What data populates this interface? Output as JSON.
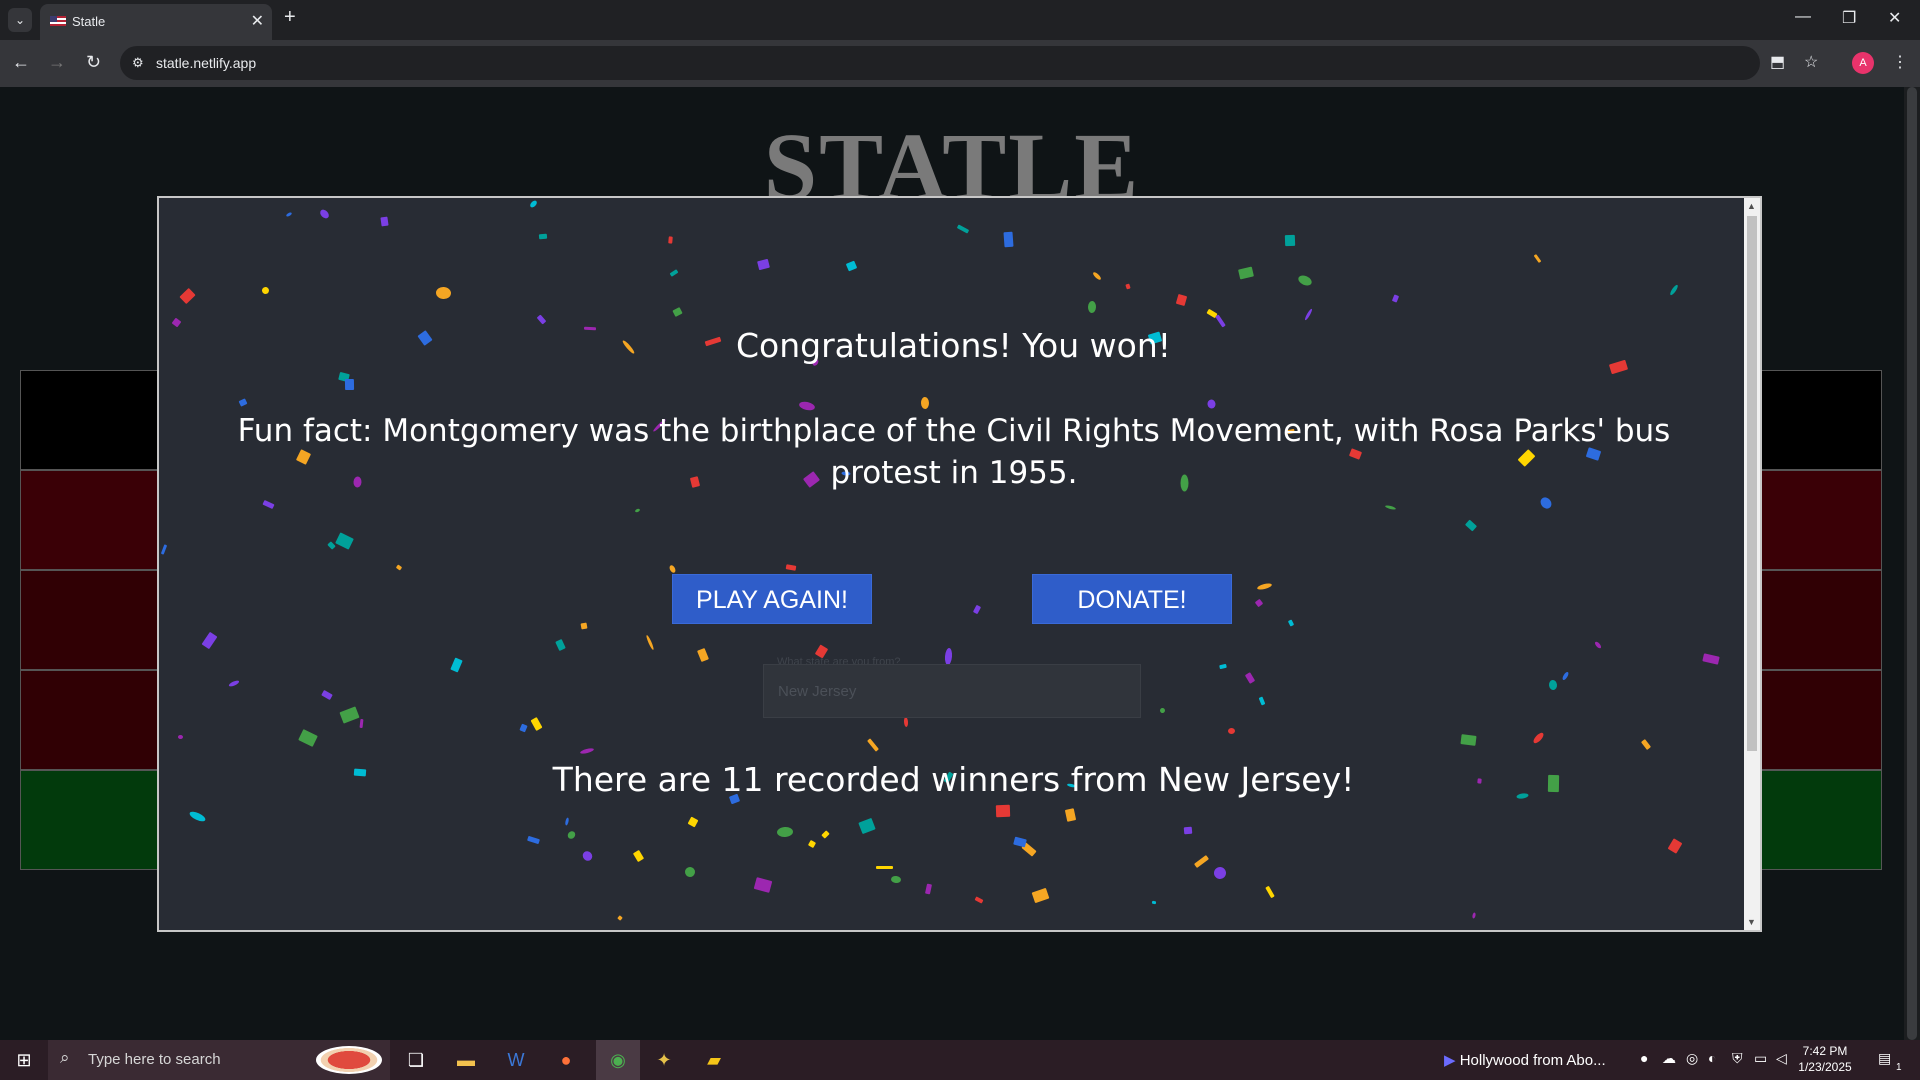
{
  "browser": {
    "tab_title": "Statle",
    "tab_close": "✕",
    "new_tab": "+",
    "url": "statle.netlify.app",
    "avatar_letter": "A"
  },
  "page": {
    "title": "STATLE"
  },
  "modal": {
    "congrats": "Congratulations! You won!",
    "fun_fact": "Fun fact: Montgomery was the birthplace of the Civil Rights Movement, with Rosa Parks' bus protest in 1955.",
    "play_again": "PLAY AGAIN!",
    "donate": "DONATE!",
    "state_label": "What state are you from?",
    "state_value": "New Jersey",
    "winners": "There are 11 recorded winners from New Jersey!"
  },
  "taskbar": {
    "search_placeholder": "Type here to search",
    "media_title": "Hollywood from Abo...",
    "time": "7:42 PM",
    "date": "1/23/2025",
    "notification_count": "1"
  },
  "colors": {
    "modal_bg": "#282c34",
    "button_bg": "#2f5dc9",
    "page_bg": "#0f1416"
  }
}
